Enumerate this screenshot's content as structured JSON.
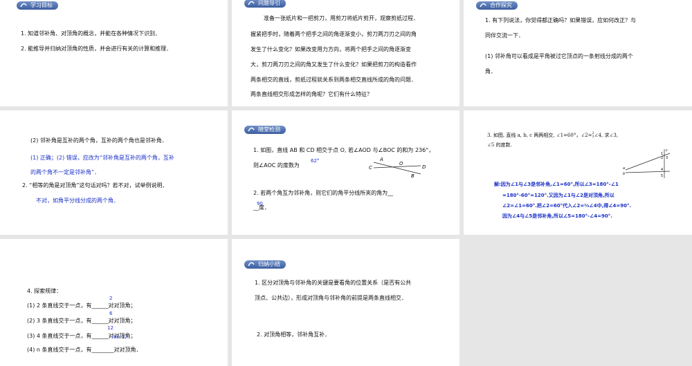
{
  "s1": {
    "tag": "学习目标",
    "line1": "1. 知道邻补角、对顶角的概念，并能在各种情况下识别．",
    "line2": "2. 能推导并归纳对顶角的性质，并会进行有关的计算和推理．"
  },
  "s2": {
    "tag": "问题导引",
    "lines": [
      "准备一张纸片和一把剪刀，用剪刀将纸片剪开，观察剪纸过程．",
      "握紧把手时，随着两个把手之间的角逐渐变小，剪刀两刀刃之间的角",
      "发生了什么变化？如果改变用力方向，将两个把手之间的角逐渐变",
      "大，剪刀两刀刃之间的角又发生了什么变化？如果把剪刀的构造看作",
      "两条相交的直线，剪纸过程就关系到两条相交直线所成的角的问题．",
      "两条直线相交形成怎样的角呢？它们有什么特征？"
    ]
  },
  "s3": {
    "tag": "合作探究",
    "l1": "1. 有下列说法，你觉得都正确吗？如果错误，应如何改正？与",
    "l2": "同伴交流一下．",
    "l3": "(1) 邻补角可以看成是平角被过它顶点的一条射线分成的两个",
    "l4": "角．"
  },
  "s4": {
    "l1": "(2) 邻补角是互补的两个角，互补的两个角也是邻补角．",
    "a1": "(1) 正确；(2) 错误，应改为“邻补角是互补的两个角，互补",
    "a2": "的两个角不一定是邻补角”．",
    "l2": "2. “相等的角是对顶角”这句话对吗？若不对，试举例说明．",
    "a3": "不对，如角平分线分成的两个角．"
  },
  "s5": {
    "tag": "随堂检测",
    "q1a": "1. 如图，直线 AB 和 CD 相交于点 O, 若∠AOD 与∠BOC 的和为 236°，",
    "q1b": "则∠AOC 的度数为",
    "ans1": "62°",
    "q2a": "2. 若两个角互为邻补角，则它们的角平分线所夹的角为__",
    "q2b": "__度．",
    "ans2": "90",
    "labels": {
      "A": "A",
      "B": "B",
      "C": "C",
      "D": "D",
      "O": "O"
    }
  },
  "s6": {
    "q1": "3. 如图, 直线 a, b, c 两两相交, ∠1=60°，∠2=",
    "frac_num": "2",
    "frac_den": "3",
    "q1b": "∠4, 求∠3,",
    "q2": "∠5 的度数.",
    "sol": [
      "解:因为∠1与∠3是邻补角,∠1=60°,所以∠3=180°-∠1",
      "=180°-60°=120°.又因为∠1与∠2是对顶角,所以",
      "∠2=∠1=60°.把∠2=60°代入∠2=⅔∠4中,得∠4=90°.",
      "因为∠4与∠5是邻补角,所以∠5=180°-∠4=90°."
    ],
    "labels": {
      "a": "a",
      "b": "b",
      "c": "c",
      "n1": "1",
      "n2": "2",
      "n3": "3",
      "n4": "4",
      "n5": "5"
    }
  },
  "s7": {
    "title": "4. 探索规律：",
    "rows": [
      {
        "text": "(1) 2 条直线交于一点，有______对对顶角；",
        "ans": "2"
      },
      {
        "text": "(2) 3 条直线交于一点，有______对对顶角；",
        "ans": "6"
      },
      {
        "text": "(3) 4 条直线交于一点，有______对对顶角；",
        "ans": "12"
      },
      {
        "text": "(4) n 条直线交于一点，有________对对顶角．",
        "ans": "n(n-1)"
      }
    ]
  },
  "s8": {
    "tag": "归纳小结",
    "l1": "1. 区分对顶角与邻补角的关键是要看角的位置关系（是否有公共",
    "l2": "顶点、公共边），形成对顶角与邻补角的前提是两条直线相交．",
    "l3": "2. 对顶角相等，邻补角互补．"
  },
  "colors": {
    "accent_blue": "#1a2fc8",
    "tag_blue": "#4f6fb0",
    "bg": "#e6e6e6"
  }
}
